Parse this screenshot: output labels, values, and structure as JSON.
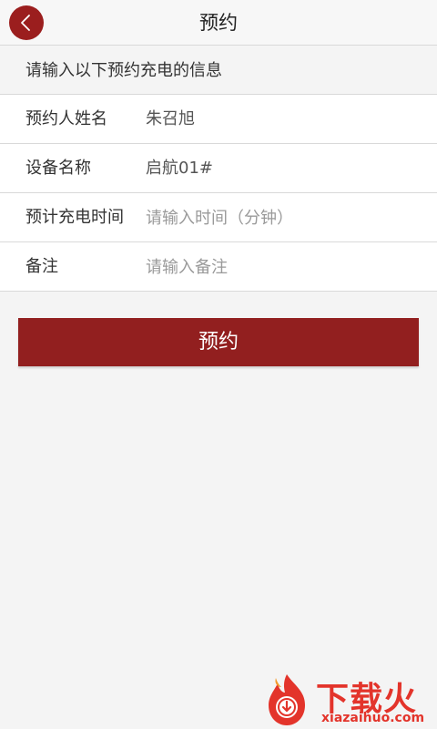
{
  "header": {
    "title": "预约",
    "back_icon": "chevron-left-icon"
  },
  "hint": "请输入以下预约充电的信息",
  "form": {
    "name_label": "预约人姓名",
    "name_value": "朱召旭",
    "device_label": "设备名称",
    "device_value": "启航01#",
    "time_label": "预计充电时间",
    "time_placeholder": "请输入时间（分钟）",
    "remark_label": "备注",
    "remark_placeholder": "请输入备注"
  },
  "submit_label": "预约",
  "watermark": {
    "cn": "下载火",
    "en": "xiazaihuo.com"
  },
  "colors": {
    "accent": "#921f1f",
    "back_button": "#9b1e1e",
    "watermark": "#e3342b"
  }
}
